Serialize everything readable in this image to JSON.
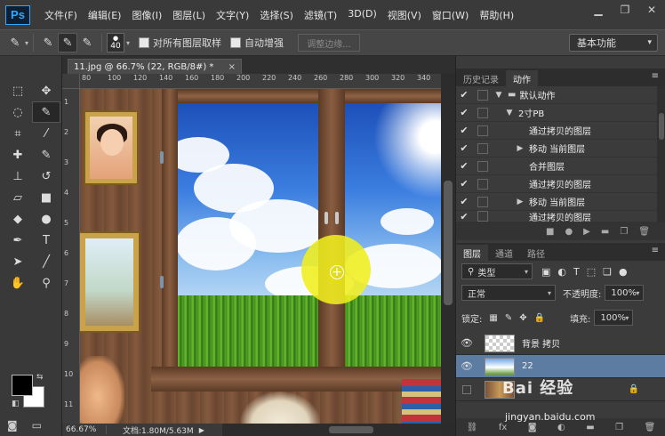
{
  "app": {
    "logo": "Ps"
  },
  "menu": [
    "文件(F)",
    "编辑(E)",
    "图像(I)",
    "图层(L)",
    "文字(Y)",
    "选择(S)",
    "滤镜(T)",
    "3D(D)",
    "视图(V)",
    "窗口(W)",
    "帮助(H)"
  ],
  "window_controls": {
    "minimize": "▁",
    "restore": "❐",
    "close": "✕"
  },
  "options": {
    "brush_size": "40",
    "sample_all_layers": "对所有图层取样",
    "auto_enhance": "自动增强",
    "refine_edge": "调整边缘...",
    "workspace": "基本功能"
  },
  "document": {
    "tab_title": "11.jpg @ 66.7% (22, RGB/8#) *",
    "close_glyph": "×",
    "ruler_h": [
      "80",
      "100",
      "120",
      "140",
      "160",
      "180",
      "200",
      "220",
      "240",
      "260",
      "280",
      "300",
      "320",
      "340"
    ],
    "ruler_v": [
      "1",
      "2",
      "3",
      "4",
      "5",
      "6",
      "7",
      "8",
      "9",
      "10",
      "11"
    ]
  },
  "status": {
    "zoom": "66.67%",
    "doc": "文档:1.80M/5.63M"
  },
  "actions_panel": {
    "tabs": [
      "历史记录",
      "动作"
    ],
    "active_tab": 1,
    "rows": [
      {
        "label": "默认动作",
        "indent": 0,
        "kind": "folder",
        "check": true
      },
      {
        "label": "2寸PB",
        "indent": 1,
        "kind": "expanded",
        "check": true
      },
      {
        "label": "通过拷贝的图层",
        "indent": 2,
        "kind": "none",
        "check": true
      },
      {
        "label": "移动 当前图层",
        "indent": 2,
        "kind": "collapsed",
        "check": true
      },
      {
        "label": "合并图层",
        "indent": 2,
        "kind": "none",
        "check": true
      },
      {
        "label": "通过拷贝的图层",
        "indent": 2,
        "kind": "none",
        "check": true
      },
      {
        "label": "移动 当前图层",
        "indent": 2,
        "kind": "collapsed",
        "check": true
      },
      {
        "label": "通过拷贝的图层",
        "indent": 2,
        "kind": "none",
        "check": true
      }
    ]
  },
  "layers_panel": {
    "tabs": [
      "图层",
      "通道",
      "路径"
    ],
    "filter": "类型",
    "blend_mode": "正常",
    "opacity_label": "不透明度:",
    "opacity": "100%",
    "lock_label": "锁定:",
    "fill_label": "填充:",
    "fill": "100%",
    "layers": [
      {
        "name": "背景 拷贝",
        "visible": true,
        "selected": false
      },
      {
        "name": "22",
        "visible": true,
        "selected": true
      },
      {
        "name": "",
        "visible": false,
        "selected": false
      }
    ]
  },
  "watermark": {
    "brand": "Bai 经验",
    "url": "jingyan.baidu.com"
  }
}
